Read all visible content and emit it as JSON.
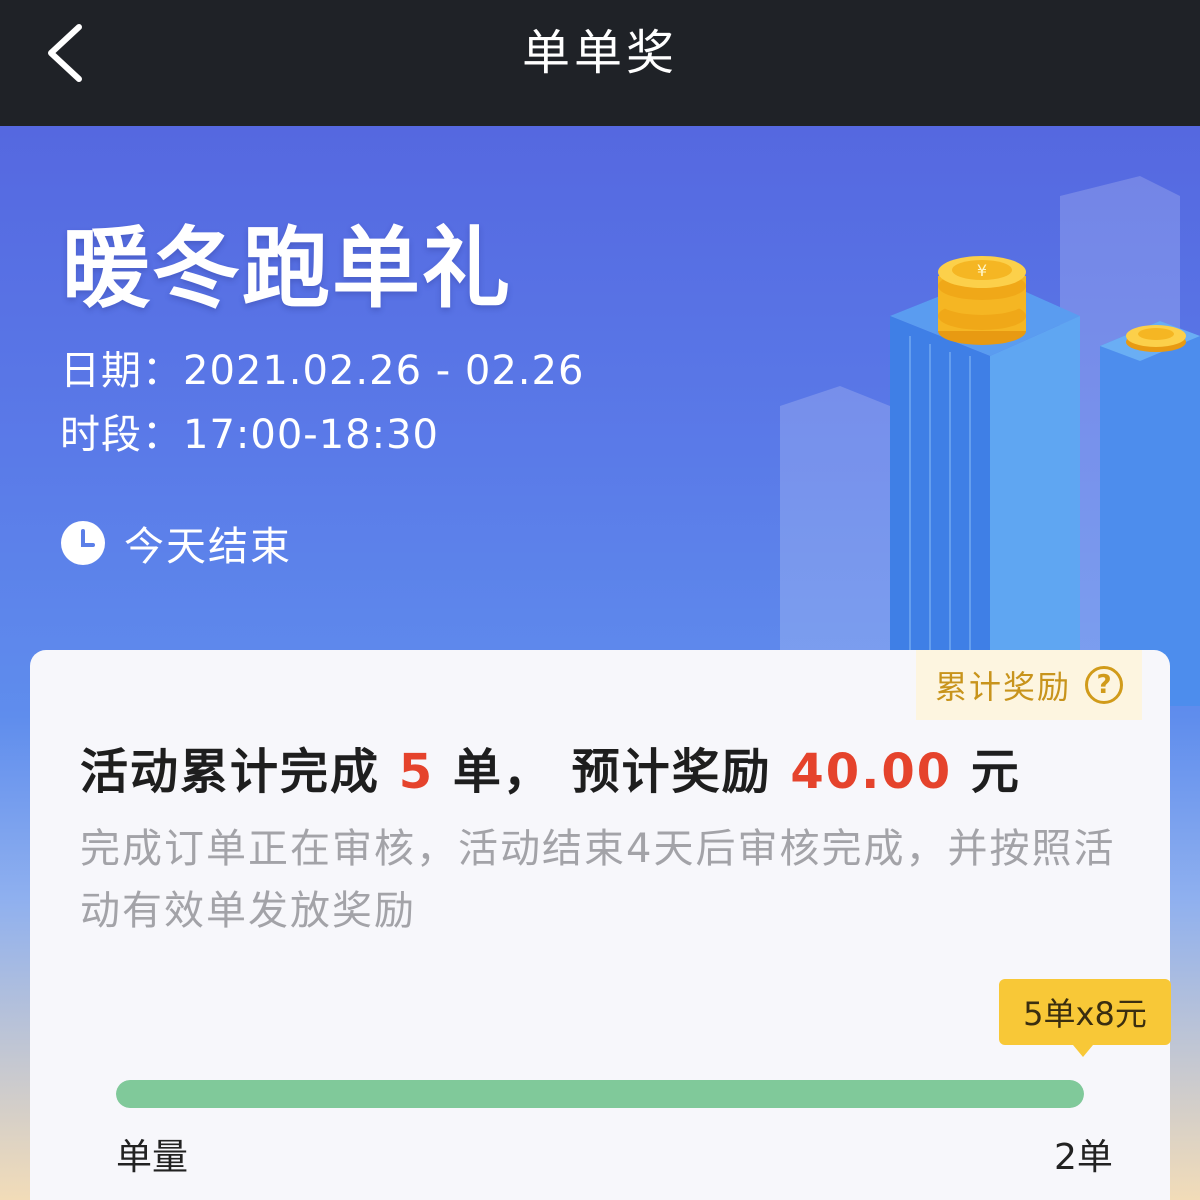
{
  "nav": {
    "title": "单单奖",
    "back_icon": "chevron-left-icon"
  },
  "hero": {
    "title": "暖冬跑单礼",
    "date_line": "日期：2021.02.26 - 02.26",
    "time_line": "时段：17:00-18:30",
    "end_icon": "clock-icon",
    "end_text": "今天结束"
  },
  "card": {
    "reward_tag": {
      "label": "累计奖励",
      "icon": "question-circle-icon"
    },
    "summary": {
      "prefix": "活动累计完成",
      "orders": "5",
      "orders_unit": "单，",
      "reward_label": "预计奖励",
      "amount": "40.00",
      "currency": "元"
    },
    "note": "完成订单正在审核，活动结束4天后审核完成，并按照活动有效单发放奖励",
    "tooltip": "5单x8元",
    "progress": {
      "fraction": 1.0,
      "left_label": "单量",
      "right_label": "2单"
    }
  },
  "colors": {
    "accent_red": "#e5432c",
    "progress_green": "#80c99a",
    "tooltip_yellow": "#f8c837",
    "tag_gold": "#d19b1a"
  }
}
